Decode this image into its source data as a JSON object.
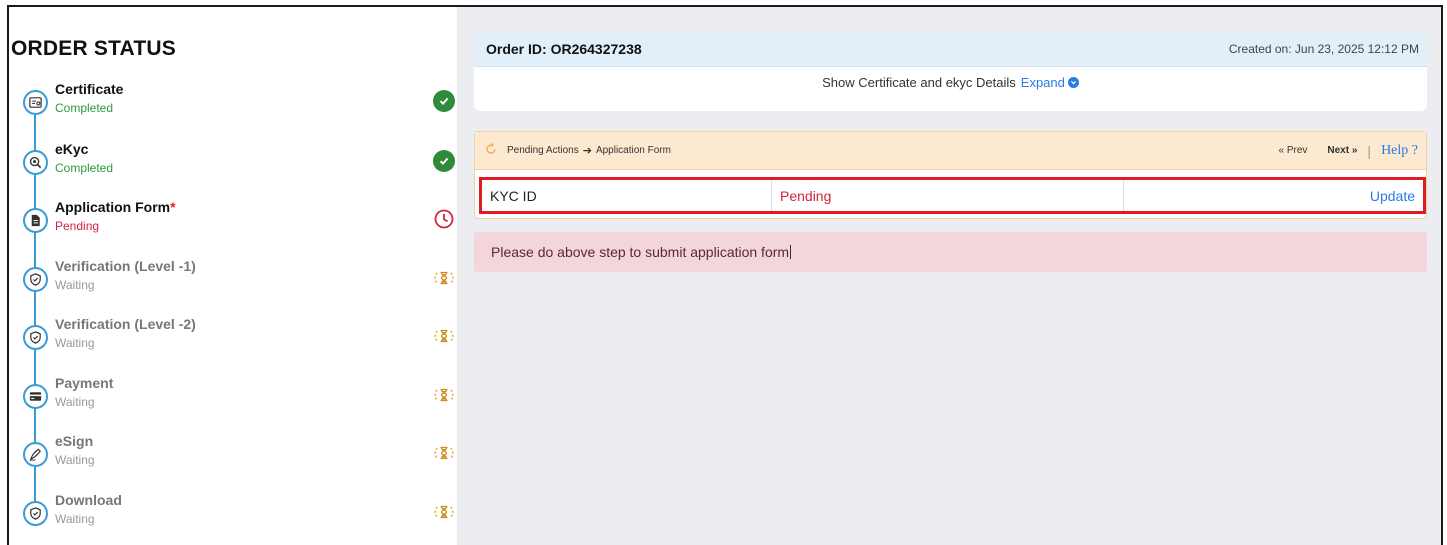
{
  "left": {
    "title": "ORDER STATUS",
    "steps": [
      {
        "name": "Certificate",
        "status": "Completed",
        "state": "completed",
        "icon": "certificate-icon"
      },
      {
        "name": "eKyc",
        "status": "Completed",
        "state": "completed",
        "icon": "search-icon"
      },
      {
        "name": "Application Form",
        "required_mark": "*",
        "status": "Pending",
        "state": "pending",
        "icon": "document-icon"
      },
      {
        "name": "Verification (Level -1)",
        "status": "Waiting",
        "state": "waiting",
        "icon": "shield-icon"
      },
      {
        "name": "Verification (Level -2)",
        "status": "Waiting",
        "state": "waiting",
        "icon": "shield-icon"
      },
      {
        "name": "Payment",
        "status": "Waiting",
        "state": "waiting",
        "icon": "card-icon"
      },
      {
        "name": "eSign",
        "status": "Waiting",
        "state": "waiting",
        "icon": "pen-icon"
      },
      {
        "name": "Download",
        "status": "Waiting",
        "state": "waiting",
        "icon": "shield-icon"
      }
    ]
  },
  "order": {
    "id_label": "Order ID: OR264327238",
    "created_on": "Created on: Jun 23, 2025 12:12 PM",
    "details_text": "Show Certificate and ekyc Details",
    "expand_label": "Expand"
  },
  "actions": {
    "crumb_start": "Pending Actions",
    "crumb_end": "Application Form",
    "prev_label": "Prev",
    "next_label": "Next",
    "help_label": "Help ?",
    "row": {
      "label": "KYC ID",
      "status": "Pending",
      "action": "Update"
    }
  },
  "alert": {
    "text": "Please do above step to submit application form"
  },
  "colors": {
    "completed": "#2e8b3a",
    "pending": "#d0253a",
    "waiting": "#f0a640",
    "accent": "#2a7be4",
    "timeline": "#3a9bd8",
    "highlight": "#e01b24"
  }
}
